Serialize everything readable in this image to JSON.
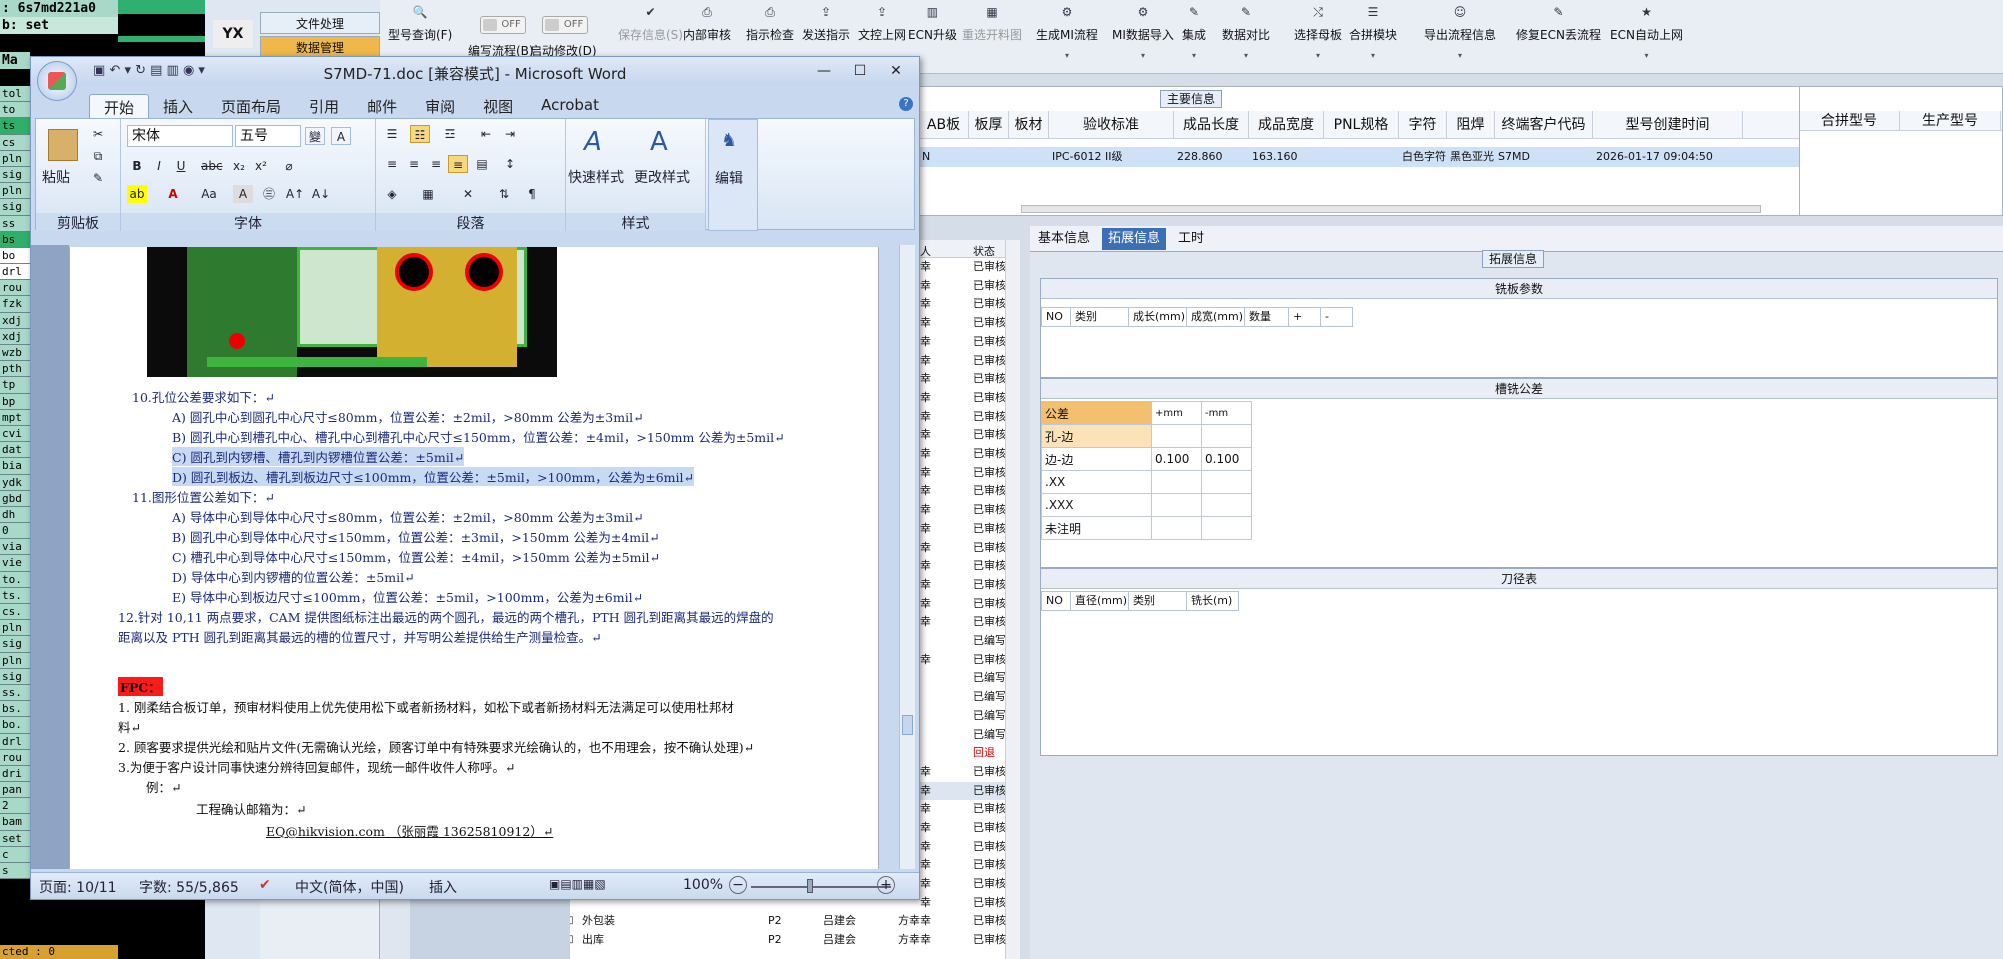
{
  "terminal": {
    "top_line1": ": 6s7md221a0",
    "top_line2": "b: set",
    "top_line3": "Ma",
    "items": [
      "tol",
      "to",
      "ts",
      "cs",
      "pln",
      "sig",
      "pln",
      "sig",
      "ss",
      "bs",
      "bo",
      "drl",
      "rou",
      "fzk",
      "xdj",
      "xdj",
      "wzb",
      "pth",
      "tp",
      "bp",
      "mpt",
      "cvi",
      "dat",
      "bia",
      "ydk",
      "gbd",
      "dh",
      "0",
      "via",
      "vie",
      "to.",
      "ts.",
      "cs.",
      "pln",
      "sig",
      "pln",
      "sig",
      "ss.",
      "bs.",
      "bo.",
      "drl",
      "rou",
      "dri",
      "pan",
      "2",
      "bam",
      "set",
      "c",
      "s"
    ],
    "bottom": "cted : 0"
  },
  "nav": {
    "logo": "YX",
    "tab1": "文件处理",
    "tab2": "数据管理"
  },
  "toolbar": {
    "items": [
      {
        "label": "型号查询(F)",
        "icon": "search-icon",
        "disabled": false
      },
      {
        "label": "编写流程(B)",
        "icon": "toggle",
        "disabled": false
      },
      {
        "label": "启动修改(D)",
        "icon": "toggle",
        "disabled": false
      },
      {
        "label": "保存信息(S)",
        "icon": "check-icon",
        "disabled": true
      },
      {
        "label": "内部审核",
        "icon": "print-icon",
        "disabled": false
      },
      {
        "label": "指示检查",
        "icon": "print-icon",
        "disabled": false
      },
      {
        "label": "发送指示",
        "icon": "upload-icon",
        "disabled": false
      },
      {
        "label": "文控上网",
        "icon": "upload-icon",
        "disabled": false
      },
      {
        "label": "ECN升级",
        "icon": "book-icon",
        "disabled": false
      },
      {
        "label": "重选开料图",
        "icon": "grid-icon",
        "disabled": true
      },
      {
        "label": "生成MI流程",
        "icon": "gears-icon",
        "disabled": false
      },
      {
        "label": "MI数据导入",
        "icon": "gears-icon",
        "disabled": false
      },
      {
        "label": "集成",
        "icon": "wrench-icon",
        "disabled": false
      },
      {
        "label": "数据对比",
        "icon": "wrench-icon",
        "disabled": false
      },
      {
        "label": "选择母板",
        "icon": "shuffle-icon",
        "disabled": false
      },
      {
        "label": "合拼模块",
        "icon": "list-icon",
        "disabled": false
      },
      {
        "label": "导出流程信息",
        "icon": "smile-icon",
        "disabled": false
      },
      {
        "label": "修复ECN丢流程",
        "icon": "wrench-icon",
        "disabled": false
      },
      {
        "label": "ECN自动上网",
        "icon": "star-icon",
        "disabled": false
      }
    ],
    "off": "OFF"
  },
  "main_info": {
    "title": "主要信息",
    "headers": [
      "AB板",
      "板厚",
      "板材",
      "验收标准",
      "成品长度",
      "成品宽度",
      "PNL规格",
      "字符",
      "阻焊",
      "终端客户代码",
      "型号创建时间"
    ],
    "row": [
      "N",
      "",
      "",
      "IPC-6012 II级",
      "228.860",
      "163.160",
      "",
      "白色字符",
      "黑色亚光",
      "S7MD",
      "2026-01-17 09:04:50"
    ],
    "right_headers": [
      "合拼型号",
      "生产型号"
    ]
  },
  "left_list": {
    "headers": [
      "人",
      "状态"
    ],
    "rows": [
      {
        "c": "幸",
        "s": "已审核"
      },
      {
        "c": "幸",
        "s": "已审核"
      },
      {
        "c": "幸",
        "s": "已审核"
      },
      {
        "c": "幸",
        "s": "已审核"
      },
      {
        "c": "幸",
        "s": "已审核"
      },
      {
        "c": "幸",
        "s": "已审核"
      },
      {
        "c": "幸",
        "s": "已审核"
      },
      {
        "c": "幸",
        "s": "已审核"
      },
      {
        "c": "幸",
        "s": "已审核"
      },
      {
        "c": "幸",
        "s": "已审核"
      },
      {
        "c": "幸",
        "s": "已审核"
      },
      {
        "c": "幸",
        "s": "已审核"
      },
      {
        "c": "幸",
        "s": "已审核"
      },
      {
        "c": "幸",
        "s": "已审核"
      },
      {
        "c": "幸",
        "s": "已审核"
      },
      {
        "c": "幸",
        "s": "已审核"
      },
      {
        "c": "幸",
        "s": "已审核"
      },
      {
        "c": "幸",
        "s": "已审核"
      },
      {
        "c": "幸",
        "s": "已审核"
      },
      {
        "c": "幸",
        "s": "已审核"
      },
      {
        "c": "",
        "s": "已编写"
      },
      {
        "c": "幸",
        "s": "已审核"
      },
      {
        "c": "",
        "s": "已编写"
      },
      {
        "c": "",
        "s": "已编写"
      },
      {
        "c": "",
        "s": "已编写"
      },
      {
        "c": "",
        "s": "已编写"
      },
      {
        "c": "",
        "s": "回退"
      },
      {
        "c": "幸",
        "s": "已审核"
      },
      {
        "c": "幸",
        "s": "已审核"
      },
      {
        "c": "幸",
        "s": "已审核"
      },
      {
        "c": "幸",
        "s": "已审核"
      },
      {
        "c": "幸",
        "s": "已审核"
      },
      {
        "c": "幸",
        "s": "已审核"
      },
      {
        "c": "幸",
        "s": "已审核"
      },
      {
        "c": "幸",
        "s": "已审核"
      }
    ],
    "bottom_rows": [
      {
        "name": "外包装",
        "p": "P2",
        "a": "吕建会",
        "b": "方幸幸",
        "s": "已审核"
      },
      {
        "name": "出库",
        "p": "P2",
        "a": "吕建会",
        "b": "方幸幸",
        "s": "已审核"
      }
    ]
  },
  "detail": {
    "tabs": [
      "基本信息",
      "拓展信息",
      "工时"
    ],
    "ext_title": "拓展信息",
    "plate_title": "铣板参数",
    "plate_headers": [
      "NO",
      "类别",
      "成长(mm)",
      "成宽(mm)",
      "数量",
      "+",
      "-"
    ],
    "slot_title": "槽铣公差",
    "slot_headers": [
      "公差",
      "+mm",
      "-mm"
    ],
    "slot_rows": [
      {
        "k": "孔-边",
        "p": "",
        "m": ""
      },
      {
        "k": "边-边",
        "p": "0.100",
        "m": "0.100"
      },
      {
        "k": ".XX",
        "p": "",
        "m": ""
      },
      {
        "k": ".XXX",
        "p": "",
        "m": ""
      },
      {
        "k": "未注明",
        "p": "",
        "m": ""
      }
    ],
    "tool_title": "刀径表",
    "tool_headers": [
      "NO",
      "直径(mm)",
      "类别",
      "铣长(m)"
    ]
  },
  "word": {
    "title": "S7MD-71.doc [兼容模式] - Microsoft Word",
    "tabs": [
      "开始",
      "插入",
      "页面布局",
      "引用",
      "邮件",
      "审阅",
      "视图",
      "Acrobat"
    ],
    "font": "宋体",
    "size": "五号",
    "paste": "粘贴",
    "groups": [
      "剪贴板",
      "字体",
      "段落",
      "样式"
    ],
    "quick_style": "快速样式",
    "change_style": "更改样式",
    "edit": "编辑",
    "lines": [
      {
        "t": "10.孔位公差要求如下：↵",
        "hl": false
      },
      {
        "t": "A) 圆孔中心到圆孔中心尺寸≤80mm，位置公差：±2mil，>80mm 公差为±3mil↵",
        "hl": false
      },
      {
        "t": "B) 圆孔中心到槽孔中心、槽孔中心到槽孔中心尺寸≤150mm，位置公差：±4mil，>150mm 公差为±5mil↵",
        "hl": false
      },
      {
        "t": "C) 圆孔到内锣槽、槽孔到内锣槽位置公差：±5mil↵",
        "hl": true
      },
      {
        "t": "D) 圆孔到板边、槽孔到板边尺寸≤100mm，位置公差：±5mil，>100mm，公差为±6mil↵",
        "hl": true
      },
      {
        "t": "11.图形位置公差如下：↵",
        "hl": false
      },
      {
        "t": "A) 导体中心到导体中心尺寸≤80mm，位置公差：±2mil，>80mm 公差为±3mil↵",
        "hl": false
      },
      {
        "t": "B) 圆孔中心到导体中心尺寸≤150mm，位置公差：±3mil，>150mm 公差为±4mil↵",
        "hl": false
      },
      {
        "t": "C) 槽孔中心到导体中心尺寸≤150mm，位置公差：±4mil，>150mm 公差为±5mil↵",
        "hl": false
      },
      {
        "t": "D) 导体中心到内锣槽的位置公差：±5mil↵",
        "hl": false
      },
      {
        "t": "E) 导体中心到板边尺寸≤100mm，位置公差：±5mil，>100mm，公差为±6mil↵",
        "hl": false
      },
      {
        "t": "12.针对 10,11 两点要求，CAM 提供图纸标注出最远的两个圆孔，最远的两个槽孔，PTH 圆孔到距离其最远的焊盘的",
        "hl": false
      },
      {
        "t": "距离以及 PTH 圆孔到距离其最远的槽的位置尺寸，并写明公差提供给生产测量检查。↵",
        "hl": false
      }
    ],
    "fpc": "FPC：",
    "fpc_lines": [
      "1. 刚柔结合板订单，预审材料使用上优先使用松下或者新扬材料，如松下或者新扬材料无法满足可以使用杜邦材",
      "料↵",
      "2. 顾客要求提供光绘和贴片文件(无需确认光绘，顾客订单中有特殊要求光绘确认的，也不用理会，按不确认处理)↵",
      "3.为便于客户设计同事快速分辨待回复邮件，现统一邮件收件人称呼。↵",
      "例：↵",
      "工程确认邮箱为：↵",
      "EQ@hikvision.com （张丽霞 13625810912）↵"
    ],
    "status": {
      "page": "页面: 10/11",
      "words": "字数: 55/5,865",
      "lang": "中文(简体，中国)",
      "mode": "插入",
      "zoom": "100%"
    }
  }
}
